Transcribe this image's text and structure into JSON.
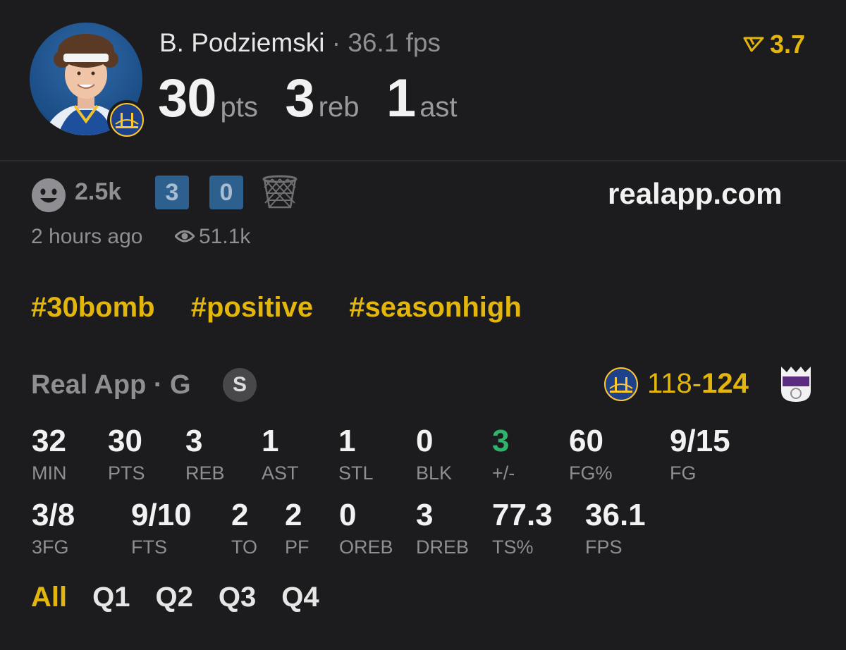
{
  "player": {
    "name": "B. Podziemski",
    "separator": "·",
    "fps_label": "36.1 fps",
    "pts": "30",
    "pts_unit": "pts",
    "reb": "3",
    "reb_unit": "reb",
    "ast": "1",
    "ast_unit": "ast"
  },
  "rating": {
    "value": "3.7",
    "color": "#e2b60c"
  },
  "reactions": {
    "count": "2.5k",
    "box1": "3",
    "box2": "0",
    "site": "realapp.com",
    "time_ago": "2 hours ago",
    "views": "51.1k"
  },
  "hashtags": [
    "#30bomb",
    "#positive",
    "#seasonhigh"
  ],
  "game": {
    "label": "Real App · G",
    "badge": "S",
    "score_home": "118",
    "score_sep": "-",
    "score_away": "124"
  },
  "stats_row1": [
    {
      "value": "32",
      "label": "MIN"
    },
    {
      "value": "30",
      "label": "PTS"
    },
    {
      "value": "3",
      "label": "REB"
    },
    {
      "value": "1",
      "label": "AST"
    },
    {
      "value": "1",
      "label": "STL"
    },
    {
      "value": "0",
      "label": "BLK"
    },
    {
      "value": "3",
      "label": "+/-"
    },
    {
      "value": "60",
      "label": "FG%"
    },
    {
      "value": "9/15",
      "label": "FG"
    }
  ],
  "stats_row2": [
    {
      "value": "3/8",
      "label": "3FG"
    },
    {
      "value": "9/10",
      "label": "FTS"
    },
    {
      "value": "2",
      "label": "TO"
    },
    {
      "value": "2",
      "label": "PF"
    },
    {
      "value": "0",
      "label": "OREB"
    },
    {
      "value": "3",
      "label": "DREB"
    },
    {
      "value": "77.3",
      "label": "TS%"
    },
    {
      "value": "36.1",
      "label": "FPS"
    }
  ],
  "tabs": [
    "All",
    "Q1",
    "Q2",
    "Q3",
    "Q4"
  ],
  "colors": {
    "accent": "#e2b60c",
    "positive": "#2db36b",
    "box": "#2d5f8f"
  }
}
